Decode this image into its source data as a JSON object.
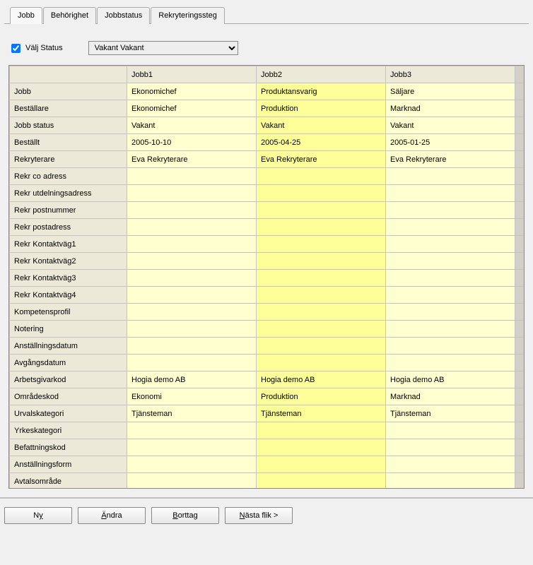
{
  "tabs": [
    "Jobb",
    "Behörighet",
    "Jobbstatus",
    "Rekryteringssteg"
  ],
  "activeTab": 0,
  "filter": {
    "checkbox_label": "Välj Status",
    "checked": true,
    "select_value": "Vakant   Vakant"
  },
  "grid": {
    "columns": [
      "Jobb1",
      "Jobb2",
      "Jobb3"
    ],
    "rows": [
      {
        "label": "Jobb",
        "cells": [
          "Ekonomichef",
          "Produktansvarig",
          "Säljare"
        ]
      },
      {
        "label": "Beställare",
        "cells": [
          "Ekonomichef",
          "Produktion",
          "Marknad"
        ]
      },
      {
        "label": "Jobb status",
        "cells": [
          "Vakant",
          "Vakant",
          "Vakant"
        ]
      },
      {
        "label": "Beställt",
        "cells": [
          "2005-10-10",
          "2005-04-25",
          "2005-01-25"
        ]
      },
      {
        "label": "Rekryterare",
        "cells": [
          "Eva Rekryterare",
          "Eva Rekryterare",
          "Eva Rekryterare"
        ]
      },
      {
        "label": "Rekr co adress",
        "cells": [
          "",
          "",
          ""
        ]
      },
      {
        "label": "Rekr utdelningsadress",
        "cells": [
          "",
          "",
          ""
        ]
      },
      {
        "label": "Rekr postnummer",
        "cells": [
          "",
          "",
          ""
        ]
      },
      {
        "label": "Rekr postadress",
        "cells": [
          "",
          "",
          ""
        ]
      },
      {
        "label": "Rekr Kontaktväg1",
        "cells": [
          "",
          "",
          ""
        ]
      },
      {
        "label": "Rekr Kontaktväg2",
        "cells": [
          "",
          "",
          ""
        ]
      },
      {
        "label": "Rekr Kontaktväg3",
        "cells": [
          "",
          "",
          ""
        ]
      },
      {
        "label": "Rekr Kontaktväg4",
        "cells": [
          "",
          "",
          ""
        ]
      },
      {
        "label": "Kompetensprofil",
        "cells": [
          "",
          "",
          ""
        ]
      },
      {
        "label": "Notering",
        "cells": [
          "",
          "",
          ""
        ]
      },
      {
        "label": "Anställningsdatum",
        "cells": [
          "",
          "",
          ""
        ]
      },
      {
        "label": "Avgångsdatum",
        "cells": [
          "",
          "",
          ""
        ]
      },
      {
        "label": "Arbetsgivarkod",
        "cells": [
          "Hogia demo AB",
          "Hogia demo AB",
          "Hogia demo AB"
        ]
      },
      {
        "label": "Områdeskod",
        "cells": [
          "Ekonomi",
          "Produktion",
          "Marknad"
        ]
      },
      {
        "label": "Urvalskategori",
        "cells": [
          "Tjänsteman",
          "Tjänsteman",
          "Tjänsteman"
        ]
      },
      {
        "label": "Yrkeskategori",
        "cells": [
          "",
          "",
          ""
        ]
      },
      {
        "label": "Befattningskod",
        "cells": [
          "",
          "",
          ""
        ]
      },
      {
        "label": "Anställningsform",
        "cells": [
          "",
          "",
          ""
        ]
      },
      {
        "label": "Avtalsområde",
        "cells": [
          "",
          "",
          ""
        ]
      },
      {
        "label": "",
        "cells": [
          "",
          "",
          ""
        ],
        "checkbox": true
      }
    ]
  },
  "buttons": {
    "ny": {
      "pre": "N",
      "mnem": "y",
      "post": ""
    },
    "andra": {
      "pre": "",
      "mnem": "Ä",
      "post": "ndra"
    },
    "borttag": {
      "pre": "",
      "mnem": "B",
      "post": "orttag"
    },
    "nasta": {
      "pre": "",
      "mnem": "N",
      "post": "ästa flik >"
    }
  }
}
